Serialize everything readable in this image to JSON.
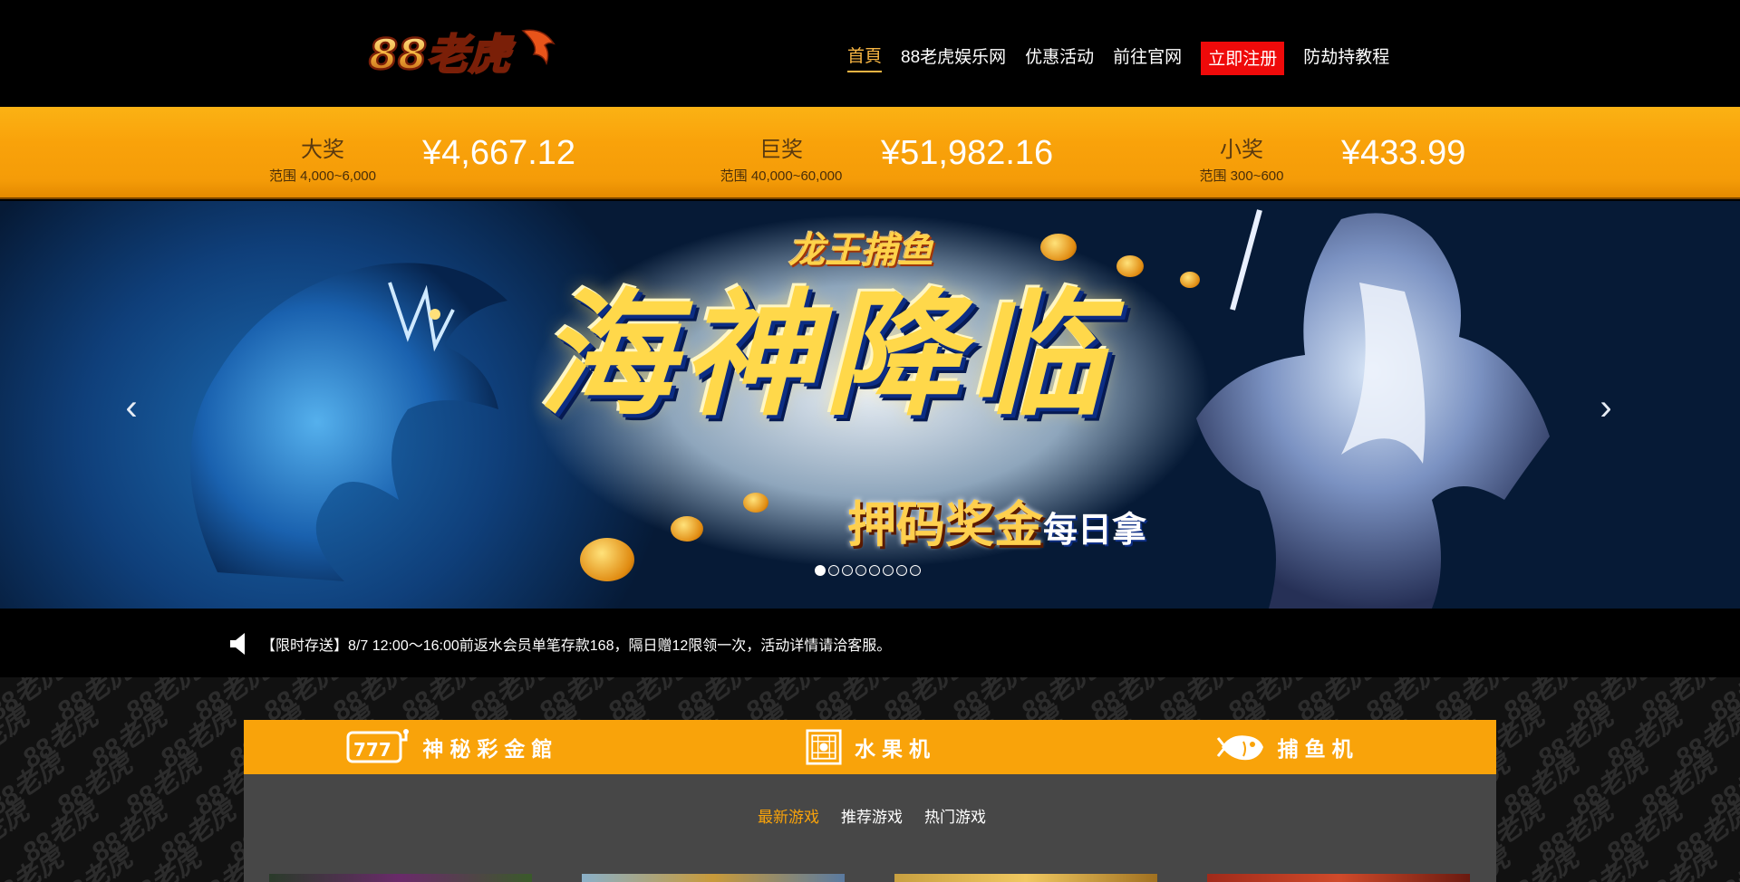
{
  "header": {
    "logo_text": "88老虎",
    "nav": [
      {
        "label": "首頁",
        "active": true
      },
      {
        "label": "88老虎娱乐网"
      },
      {
        "label": "优惠活动"
      },
      {
        "label": "前往官网"
      },
      {
        "label": "立即注册",
        "highlight": true
      },
      {
        "label": "防劫持教程"
      }
    ]
  },
  "jackpots": [
    {
      "name": "大奖",
      "range": "范围 4,000~6,000",
      "value": "¥4,667.12"
    },
    {
      "name": "巨奖",
      "range": "范围 40,000~60,000",
      "value": "¥51,982.16"
    },
    {
      "name": "小奖",
      "range": "范围 300~600",
      "value": "¥433.99"
    }
  ],
  "banner": {
    "game_logo": "龙王捕鱼",
    "title": "海神降临",
    "subtitle": "押码奖金",
    "subtitle_small": "每日拿",
    "prev_icon": "chevron-left-icon",
    "next_icon": "chevron-right-icon",
    "slide_count": 8,
    "active_slide": 1
  },
  "notice": {
    "icon": "speaker-icon",
    "text": "【限时存送】8/7 12:00～16:00前返水会员单笔存款168，隔日赠12限领一次，活动详情请洽客服。"
  },
  "watermark_text": "88老虎",
  "categories": [
    {
      "label": "神秘彩金館",
      "icon": "slot-777-icon"
    },
    {
      "label": "水果机",
      "icon": "fruit-machine-icon"
    },
    {
      "label": "捕鱼机",
      "icon": "fish-icon"
    }
  ],
  "game_tabs": [
    {
      "label": "最新游戏",
      "active": true
    },
    {
      "label": "推荐游戏"
    },
    {
      "label": "热门游戏"
    }
  ],
  "colors": {
    "accent": "#f9a30a",
    "nav_active": "#f7b543",
    "register_bg": "#ef0a0a",
    "panel_bg": "#474747"
  }
}
